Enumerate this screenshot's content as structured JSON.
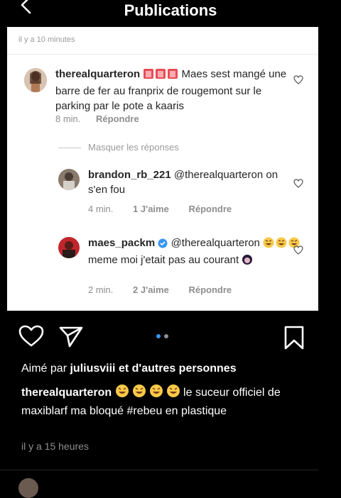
{
  "header": {
    "title": "Publications"
  },
  "feed": {
    "top_time": "il y a 10 minutes",
    "main_comment": {
      "username": "therealquarteron",
      "text": "Maes sest mangé une barre de fer au franprix de rougemont sur le parking par le pote a kaaris",
      "time": "8 min.",
      "reply": "Répondre"
    },
    "hide_replies": "Masquer les réponses",
    "replies": [
      {
        "username": "brandon_rb_221",
        "mention": "@therealquarteron",
        "text": "on s'en fou",
        "time": "4 min.",
        "likes": "1 J'aime",
        "reply": "Répondre"
      },
      {
        "username": "maes_packm",
        "mention": "@therealquarteron",
        "text": "meme moi j'etait pas au courant",
        "time": "2 min.",
        "likes": "2 J'aime",
        "reply": "Répondre"
      }
    ]
  },
  "post": {
    "liked_by_prefix": "Aimé par",
    "liked_by_user": "juliusviii",
    "liked_by_suffix": "et d'autres personnes",
    "caption_user": "therealquarteron",
    "caption_text": "le suceur officiel de maxiblarf ma bloqué #rebeu en plastique",
    "time": "il y a 15 heures"
  },
  "icons": [
    "back-arrow-icon",
    "heart-icon",
    "send-icon",
    "bookmark-icon",
    "police-light-emoji",
    "laughing-emoji"
  ],
  "colors": {
    "background": "#000000",
    "card": "#ffffff",
    "verified": "#3897f0",
    "carousel_active": "#3897f0"
  }
}
